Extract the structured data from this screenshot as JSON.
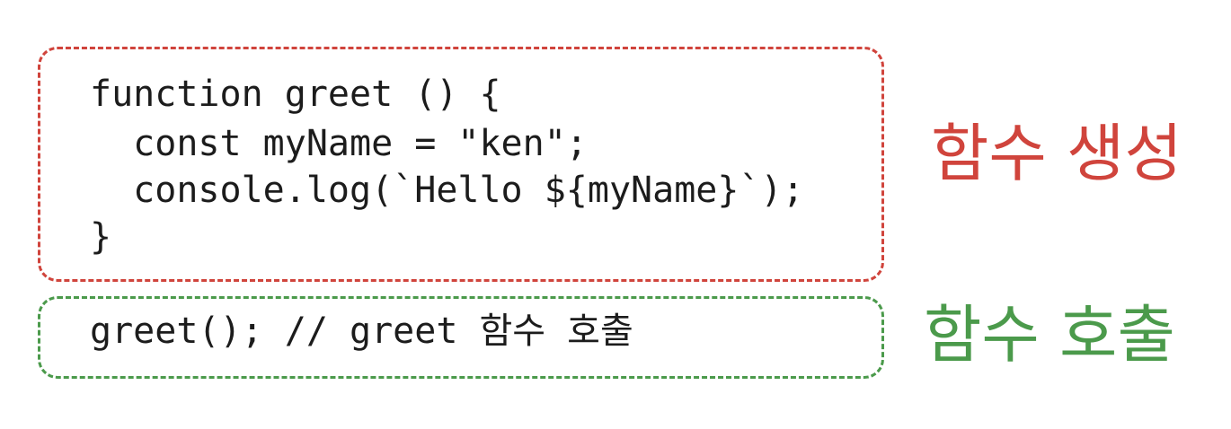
{
  "colors": {
    "definition_accent": "#d0443c",
    "call_accent": "#4b9a4b",
    "code_text": "#1c1c1c"
  },
  "definition_block": {
    "lines": [
      "function greet () {",
      "  const myName = \"ken\";",
      "  console.log(`Hello ${myName}`);",
      "}"
    ],
    "label": "함수  생성"
  },
  "call_block": {
    "lines": [
      "greet(); // greet 함수 호출"
    ],
    "label": "함수  호출"
  }
}
